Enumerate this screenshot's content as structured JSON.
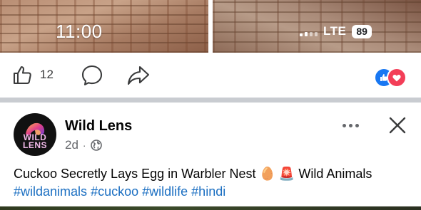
{
  "status_bar": {
    "time": "11:00",
    "network": "LTE",
    "battery": "89"
  },
  "previous_post": {
    "like_count": "12"
  },
  "colors": {
    "brand_blue": "#1877f2",
    "love_red": "#f33e58",
    "hashtag_blue": "#1b6fc2",
    "meta_gray": "#65676b"
  },
  "post": {
    "author": "Wild Lens",
    "avatar_text_line1": "WILD",
    "avatar_text_line2": "LENS",
    "time_ago": "2d",
    "separator": "·",
    "text_main": "Cuckoo Secretly Lays Egg in Warbler Nest ",
    "emoji_egg": "🥚",
    "emoji_siren": "🚨",
    "text_after": " Wild Animals ",
    "hashtags": [
      "#wildanimals",
      "#cuckoo",
      "#wildlife",
      "#hindi"
    ]
  },
  "icons": {
    "like": "thumbs-up-icon",
    "comment": "comment-bubble-icon",
    "share": "share-arrow-icon",
    "privacy": "globe-icon",
    "more": "more-dots-icon",
    "close": "close-icon"
  }
}
